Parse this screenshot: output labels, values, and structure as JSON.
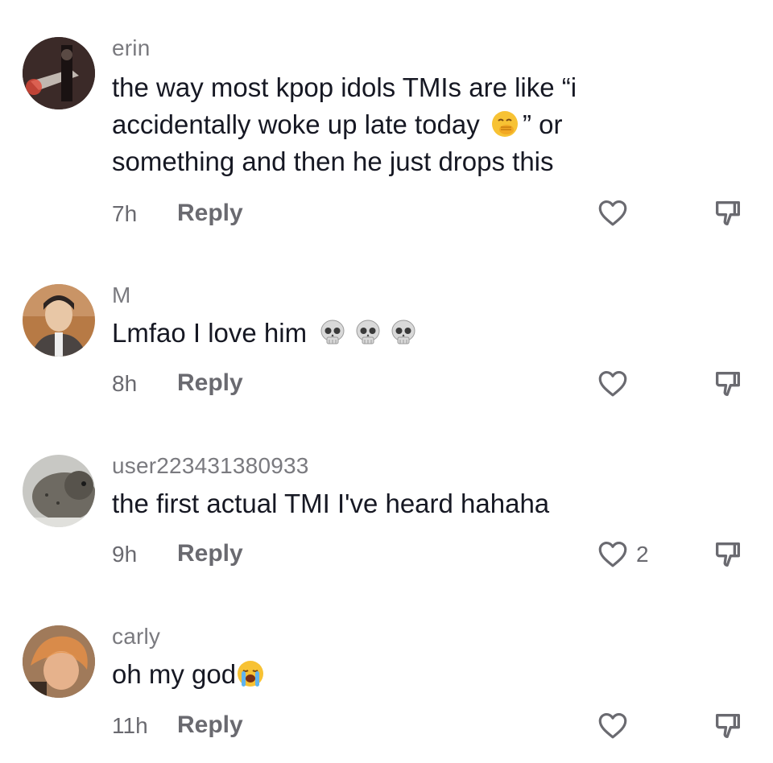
{
  "comments": [
    {
      "username": "erin",
      "text_before": "the way most kpop idols TMIs are like “i accidentally woke up late today ",
      "emoji_inline": "hand-over-mouth-emoji",
      "text_after": "” or something and then he just drops this",
      "time": "7h",
      "reply_label": "Reply",
      "like_count": ""
    },
    {
      "username": "M",
      "text": "Lmfao I love him",
      "emojis": [
        "skull-emoji",
        "skull-emoji",
        "skull-emoji"
      ],
      "time": "8h",
      "reply_label": "Reply",
      "like_count": ""
    },
    {
      "username": "user223431380933",
      "text": "the first actual TMI I've heard hahaha",
      "time": "9h",
      "reply_label": "Reply",
      "like_count": "2"
    },
    {
      "username": "carly",
      "text": "oh my god",
      "emoji_inline": "loudly-crying-emoji",
      "time": "11h",
      "reply_label": "Reply",
      "like_count": ""
    }
  ],
  "colors": {
    "username": "#7a7a7f",
    "text": "#161823",
    "meta": "#6a6a70"
  }
}
